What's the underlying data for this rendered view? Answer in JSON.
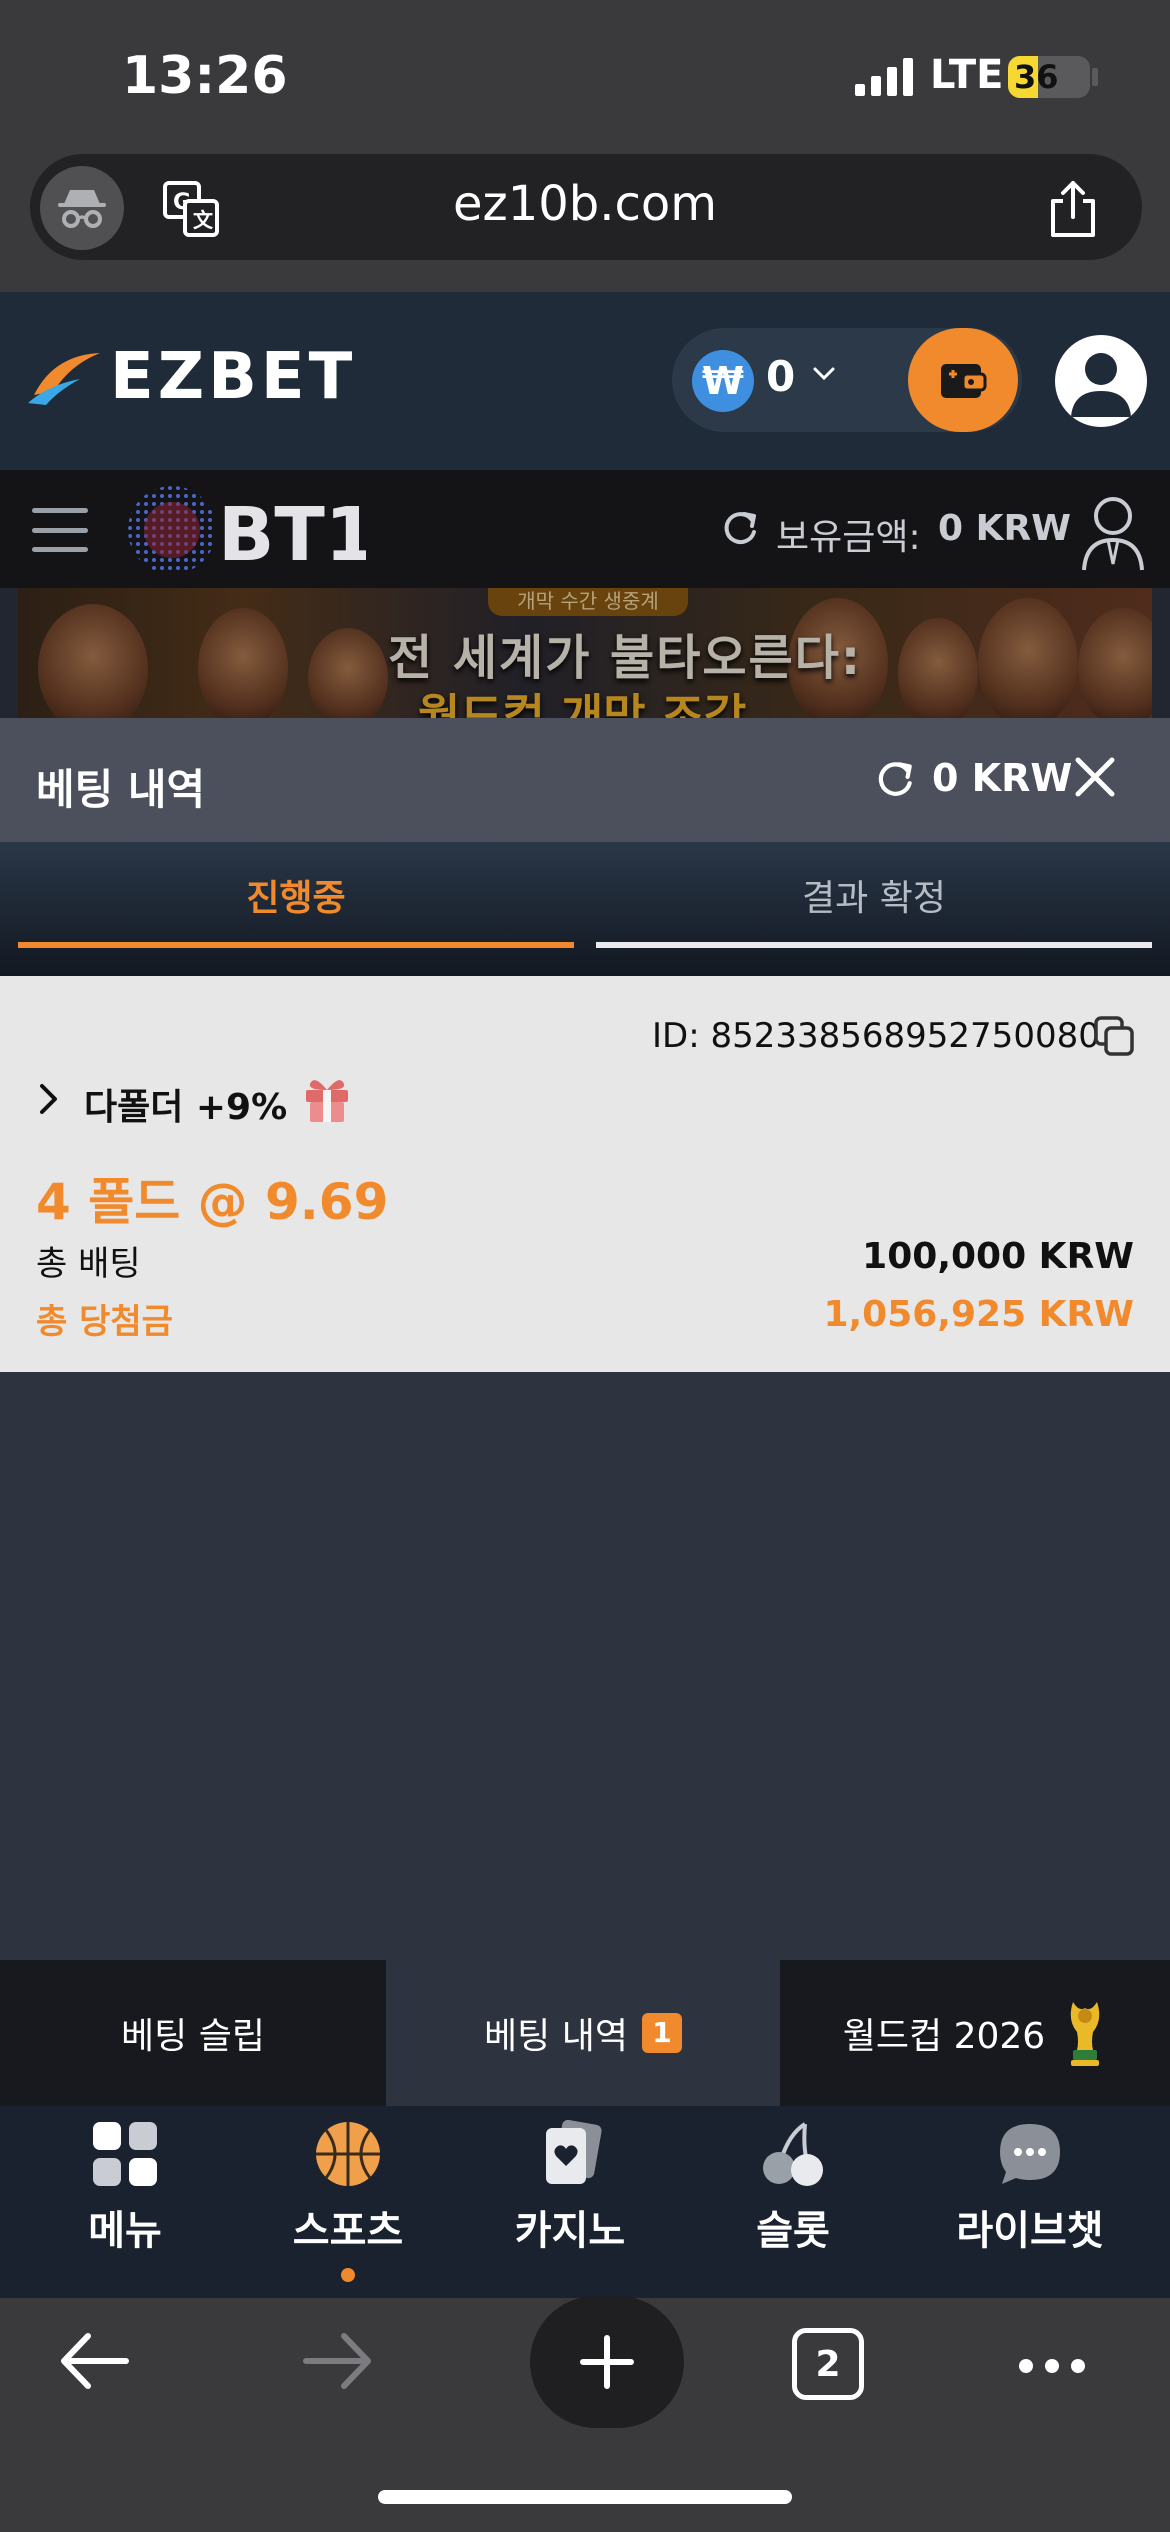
{
  "status_bar": {
    "time": "13:26",
    "network": "LTE",
    "battery": "36",
    "battery_level": 0.36
  },
  "browser": {
    "url": "ez10b.com",
    "tab_count": "2"
  },
  "site_header": {
    "logo": "EZBET",
    "currency_symbol": "₩",
    "balance": "0"
  },
  "bt1_bar": {
    "logo": "BT1",
    "holding_label": "보유금액:",
    "holding_value": "0 KRW"
  },
  "banner": {
    "top_label": "개막 수간 생중계",
    "headline": "전 세계가 불타오른다:",
    "subline": "월드컵 개막 조각"
  },
  "panel": {
    "title": "베팅 내역",
    "balance": "0 KRW"
  },
  "tabs": {
    "in_progress": "진행중",
    "settled": "결과 확정"
  },
  "bet": {
    "id": "ID: 852338568952750080",
    "type": "다폴더 +9%",
    "fold_odds": "4 폴드 @ 9.69",
    "total_bet_label": "총 배팅",
    "total_bet_value": "100,000 KRW",
    "total_win_label": "총 당첨금",
    "total_win_value": "1,056,925 KRW"
  },
  "slip_tabs": {
    "betslip": "베팅 슬립",
    "history": "베팅 내역",
    "history_badge": "1",
    "worldcup": "월드컵 2026"
  },
  "nav": {
    "items": [
      {
        "label": "메뉴",
        "icon": "grid-icon"
      },
      {
        "label": "스포츠",
        "icon": "basketball-icon"
      },
      {
        "label": "카지노",
        "icon": "cards-icon"
      },
      {
        "label": "슬롯",
        "icon": "cherry-icon"
      },
      {
        "label": "라이브챗",
        "icon": "chat-icon"
      }
    ],
    "active": "스포츠"
  },
  "colors": {
    "accent": "#f08a2c",
    "header_bg": "#1f2b38",
    "card_bg": "#e7e7e7",
    "page_bg": "#2e3340"
  }
}
